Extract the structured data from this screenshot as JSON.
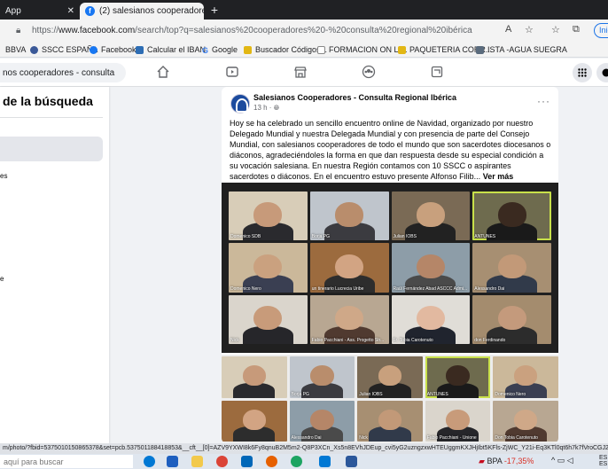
{
  "browser": {
    "tabs": [
      {
        "label": "App",
        "active": false
      },
      {
        "label": "(2) salesianos cooperadores - co",
        "active": true
      }
    ],
    "new_tab_glyph": "+",
    "close_glyph": "✕",
    "address_prefix": "https://",
    "address_domain": "www.facebook.com",
    "address_path": "/search/top?q=salesianos%20cooperadores%20-%20consulta%20regional%20ibérica",
    "profile_label": "Inic"
  },
  "bookmarks": [
    {
      "label": "BBVA",
      "icon": "bbva-icon",
      "color": "#004481"
    },
    {
      "label": "SSCC ESPAÑA",
      "icon": "sscc-icon",
      "color": "#3b5998"
    },
    {
      "label": "Facebook",
      "icon": "facebook-icon",
      "color": "#1877f2"
    },
    {
      "label": "Calcular el IBAN",
      "icon": "iban-icon",
      "color": "#2d6db4"
    },
    {
      "label": "Google",
      "icon": "google-icon",
      "color": "#4285f4"
    },
    {
      "label": "Buscador Códigos...",
      "icon": "folder-icon",
      "color": "#e2b714"
    },
    {
      "label": "FORMACION ON LI...",
      "icon": "page-icon",
      "color": "#888888"
    },
    {
      "label": "PAQUETERIA CORR...",
      "icon": "folder-icon",
      "color": "#e2b714"
    },
    {
      "label": "ISTA -AGUA SUEGRA",
      "icon": "ista-icon",
      "color": "#5a6b7d"
    }
  ],
  "facebook": {
    "search_value": "nos cooperadores - consulta",
    "left_panel": {
      "title": "de la búsqueda",
      "labels": [
        "es",
        "e"
      ]
    },
    "post": {
      "author": "Salesianos Cooperadores - Consulta Regional Ibérica",
      "meta": "13 h · ",
      "text": "Hoy se ha celebrado un sencillo encuentro online de Navidad, organizado por nuestro Delegado Mundial y nuestra Delegada Mundial y con presencia de parte del Consejo Mundial, con salesianos cooperadores de todo el mundo que son sacerdotes diocesanos o diáconos, agradeciéndoles la forma en que dan respuesta desde su especial condición a su vocación salesiana. En nuestra Región contamos con 10 SSCC o aspirantes sacerdotes o diáconos. En el encuentro estuvo presente Alfonso Filib...",
      "see_more": "Ver más",
      "more_glyph": "···"
    },
    "grid1_names": [
      "Domenico SDB",
      "Borja PG",
      "Julian IOBS",
      "ANTUNES",
      "Domenico Nero",
      "un tinerario Lucrecia Uribe",
      "Raúl Fernández Abad ASCCC Admi...",
      "Alessandro Dai",
      "Nick",
      "Fabio Pacchiani - Ass. Progetto Str...",
      "Fr. Tobia Carotenuto",
      "don Ferdinando"
    ],
    "grid2_names": [
      "",
      "Borja PG",
      "Julian IOBS",
      "ANTUNES",
      "Domenico Nero",
      "",
      "Alessandro Dai",
      "Nick",
      "Fabio Pacchiani - Unione",
      "Don Tobia Carotenuto"
    ]
  },
  "status_url": "m/photo/?fbid=5375010150865378&set=pcb.537501188418853&__cft__[0]=AZV9YXWI8k6Fy8qnuB2M5m2-Q8P3XCn_Xs5n8EVhJDEup_cvi5yG2uzngzxwHTEUggmKXJHjIbt5KFls-ZjWC_Y21i-Eq3KTl0qt6h7k7fVroCGJ2M4r5I1",
  "taskbar": {
    "search_placeholder": "aquí para buscar",
    "weather_label": "BPA",
    "weather_value": "-17,35%",
    "lang_top": "ES",
    "lang_bottom": "ES"
  },
  "colors": {
    "accent": "#1877f2",
    "chrome_dark": "#202124",
    "negative": "#d93025"
  }
}
